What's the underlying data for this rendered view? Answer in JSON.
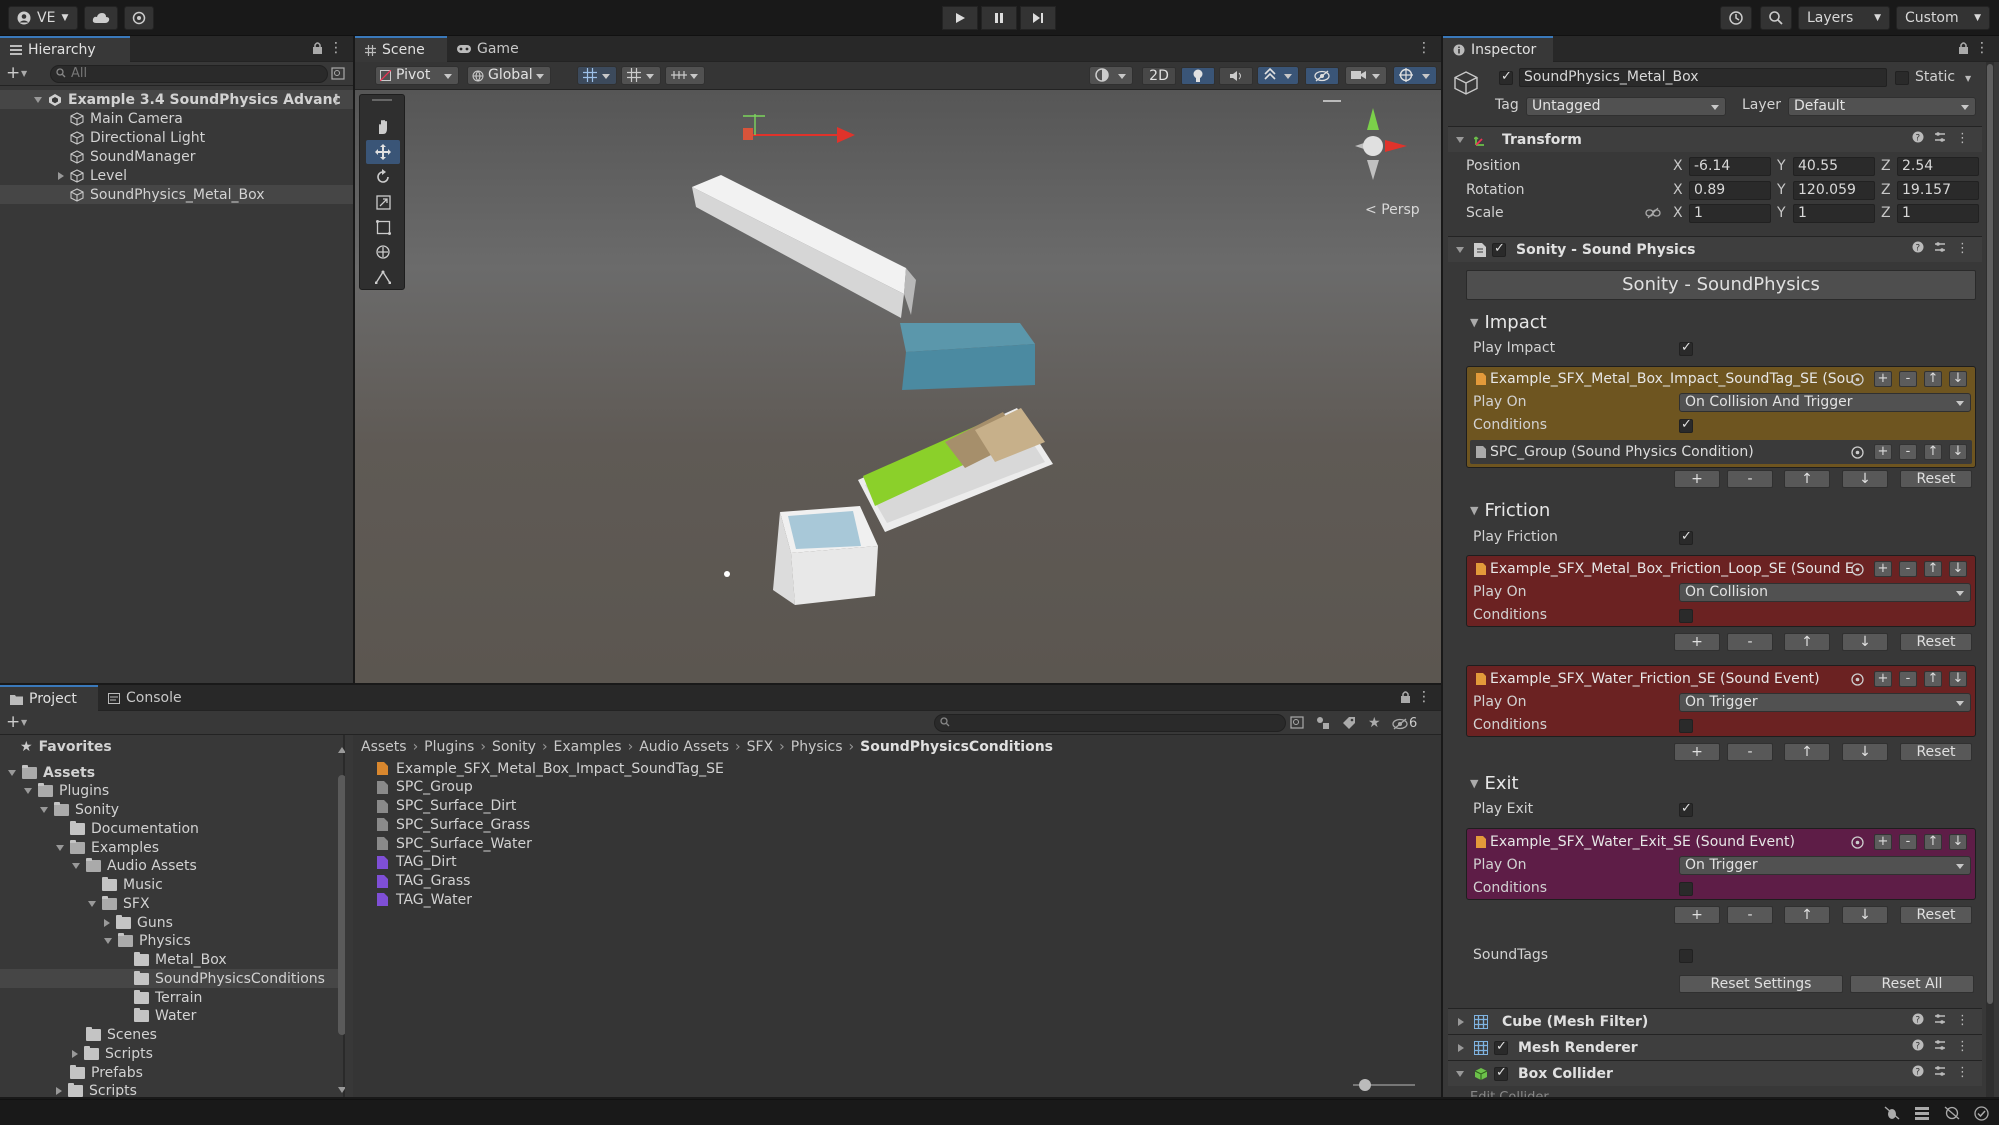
{
  "topbar": {
    "account": "VE",
    "layers": "Layers",
    "layout": "Custom"
  },
  "hierarchy": {
    "tab": "Hierarchy",
    "search_placeholder": "All",
    "scene": "Example 3.4 SoundPhysics Advanc",
    "items": [
      "Main Camera",
      "Directional Light",
      "SoundManager",
      "Level",
      "SoundPhysics_Metal_Box"
    ]
  },
  "scene": {
    "tabs": [
      "Scene",
      "Game"
    ],
    "pivot": "Pivot",
    "global": "Global",
    "mode2d": "2D",
    "persp": "Persp"
  },
  "project": {
    "tabs": [
      "Project",
      "Console"
    ],
    "favorites": "Favorites",
    "tree": [
      {
        "label": "Assets",
        "depth": 0,
        "bold": true
      },
      {
        "label": "Plugins",
        "depth": 1
      },
      {
        "label": "Sonity",
        "depth": 2
      },
      {
        "label": "Documentation",
        "depth": 3
      },
      {
        "label": "Examples",
        "depth": 3
      },
      {
        "label": "Audio Assets",
        "depth": 4
      },
      {
        "label": "Music",
        "depth": 5
      },
      {
        "label": "SFX",
        "depth": 5
      },
      {
        "label": "Guns",
        "depth": 6
      },
      {
        "label": "Physics",
        "depth": 6
      },
      {
        "label": "Metal_Box",
        "depth": 7
      },
      {
        "label": "SoundPhysicsConditions",
        "depth": 7,
        "selected": true
      },
      {
        "label": "Terrain",
        "depth": 7
      },
      {
        "label": "Water",
        "depth": 7
      },
      {
        "label": "Scenes",
        "depth": 4
      },
      {
        "label": "Scripts",
        "depth": 4
      },
      {
        "label": "Prefabs",
        "depth": 3
      },
      {
        "label": "Scripts",
        "depth": 3
      }
    ],
    "breadcrumb": [
      "Assets",
      "Plugins",
      "Sonity",
      "Examples",
      "Audio Assets",
      "SFX",
      "Physics",
      "SoundPhysicsConditions"
    ],
    "files": [
      {
        "name": "Example_SFX_Metal_Box_Impact_SoundTag_SE",
        "color": "#d9872e"
      },
      {
        "name": "SPC_Group",
        "color": "#8a8a8a"
      },
      {
        "name": "SPC_Surface_Dirt",
        "color": "#8a8a8a"
      },
      {
        "name": "SPC_Surface_Grass",
        "color": "#8a8a8a"
      },
      {
        "name": "SPC_Surface_Water",
        "color": "#8a8a8a"
      },
      {
        "name": "TAG_Dirt",
        "color": "#7f4fd6"
      },
      {
        "name": "TAG_Grass",
        "color": "#7f4fd6"
      },
      {
        "name": "TAG_Water",
        "color": "#7f4fd6"
      }
    ],
    "hidden_count": "6"
  },
  "inspector": {
    "tab": "Inspector",
    "object_name": "SoundPhysics_Metal_Box",
    "static": "Static",
    "tag_label": "Tag",
    "tag": "Untagged",
    "layer_label": "Layer",
    "layer": "Default",
    "transform": {
      "title": "Transform",
      "position_label": "Position",
      "position": [
        "-6.14",
        "40.55",
        "2.54"
      ],
      "rotation_label": "Rotation",
      "rotation": [
        "0.89",
        "120.059",
        "19.157"
      ],
      "scale_label": "Scale",
      "scale": [
        "1",
        "1",
        "1"
      ],
      "axes": [
        "X",
        "Y",
        "Z"
      ]
    },
    "sonity": {
      "title": "Sonity - Sound Physics",
      "banner": "Sonity - SoundPhysics",
      "impact": {
        "title": "Impact",
        "play_label": "Play Impact",
        "event": "Example_SFX_Metal_Box_Impact_SoundTag_SE (Sou",
        "play_on_label": "Play On",
        "play_on": "On Collision And Trigger",
        "conditions_label": "Conditions",
        "condition": "SPC_Group (Sound Physics Condition)"
      },
      "friction": {
        "title": "Friction",
        "play_label": "Play Friction",
        "event1": "Example_SFX_Metal_Box_Friction_Loop_SE (Sound E",
        "play_on1": "On Collision",
        "event2": "Example_SFX_Water_Friction_SE (Sound Event)",
        "play_on2": "On Trigger",
        "play_on_label": "Play On",
        "conditions_label": "Conditions"
      },
      "exit": {
        "title": "Exit",
        "play_label": "Play Exit",
        "event": "Example_SFX_Water_Exit_SE (Sound Event)",
        "play_on_label": "Play On",
        "play_on": "On Trigger",
        "conditions_label": "Conditions"
      },
      "buttons": {
        "plus": "+",
        "minus": "-",
        "up": "↑",
        "down": "↓",
        "reset": "Reset"
      },
      "soundtags_label": "SoundTags",
      "reset_settings": "Reset Settings",
      "reset_all": "Reset All"
    },
    "components": [
      "Cube (Mesh Filter)",
      "Mesh Renderer",
      "Box Collider"
    ],
    "box_collider_sub": "Edit Collider"
  },
  "colors": {
    "impact_box": "#6e5520",
    "friction_box": "#6b2222",
    "exit_box": "#5e1d47",
    "accent": "#3a79bb"
  }
}
